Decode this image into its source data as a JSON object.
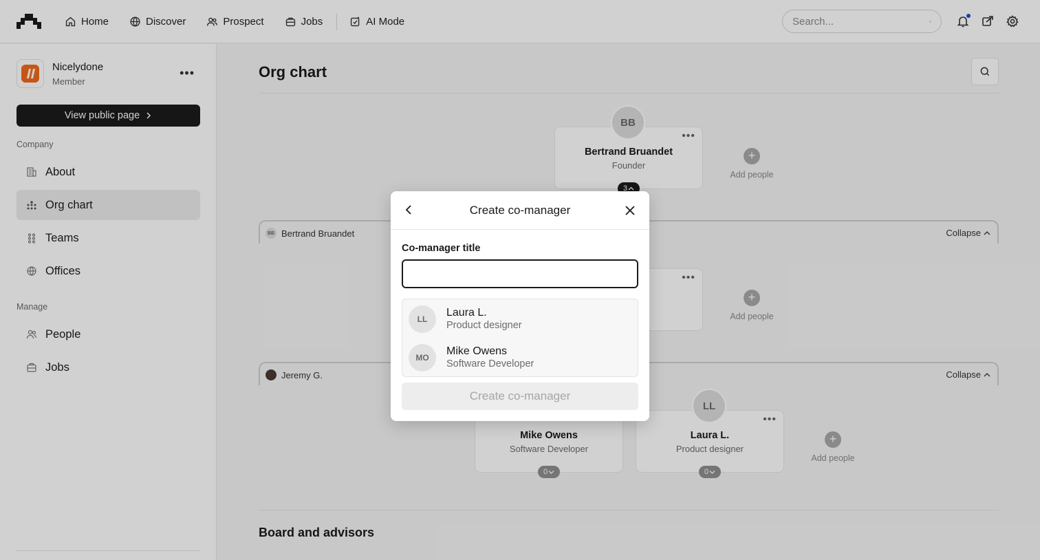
{
  "topbar": {
    "nav": [
      {
        "label": "Home",
        "icon": "home-icon"
      },
      {
        "label": "Discover",
        "icon": "globe-icon"
      },
      {
        "label": "Prospect",
        "icon": "users-icon"
      },
      {
        "label": "Jobs",
        "icon": "briefcase-icon"
      },
      {
        "label": "AI Mode",
        "icon": "ai-sparkle-icon"
      }
    ],
    "search_placeholder": "Search..."
  },
  "sidebar": {
    "org_name": "Nicelydone",
    "org_role": "Member",
    "public_button": "View public page",
    "section_company": "Company",
    "company_items": [
      {
        "label": "About",
        "icon": "building-icon"
      },
      {
        "label": "Org chart",
        "icon": "org-chart-icon"
      },
      {
        "label": "Teams",
        "icon": "teams-icon"
      },
      {
        "label": "Offices",
        "icon": "globe-icon"
      }
    ],
    "section_manage": "Manage",
    "manage_items": [
      {
        "label": "People",
        "icon": "people-icon"
      },
      {
        "label": "Jobs",
        "icon": "briefcase-icon"
      }
    ]
  },
  "main": {
    "title": "Org chart",
    "root": {
      "initials": "BB",
      "name": "Bertrand Bruandet",
      "role": "Founder",
      "count": "3"
    },
    "add_people": "Add people",
    "group1": {
      "name": "Bertrand Bruandet",
      "initials": "BB",
      "collapse": "Collapse"
    },
    "group2": {
      "name": "Jeremy G.",
      "collapse": "Collapse"
    },
    "cards": [
      {
        "name": "Mike Owens",
        "role": "Software Developer",
        "count": "0"
      },
      {
        "initials": "LL",
        "name": "Laura L.",
        "role": "Product designer",
        "count": "0"
      }
    ],
    "board_title": "Board and advisors"
  },
  "modal": {
    "title": "Create co-manager",
    "field_label": "Co-manager title",
    "field_value": "",
    "suggestions": [
      {
        "initials": "LL",
        "name": "Laura L.",
        "role": "Product designer"
      },
      {
        "initials": "MO",
        "name": "Mike Owens",
        "role": "Software Developer"
      }
    ],
    "submit_label": "Create co-manager"
  }
}
